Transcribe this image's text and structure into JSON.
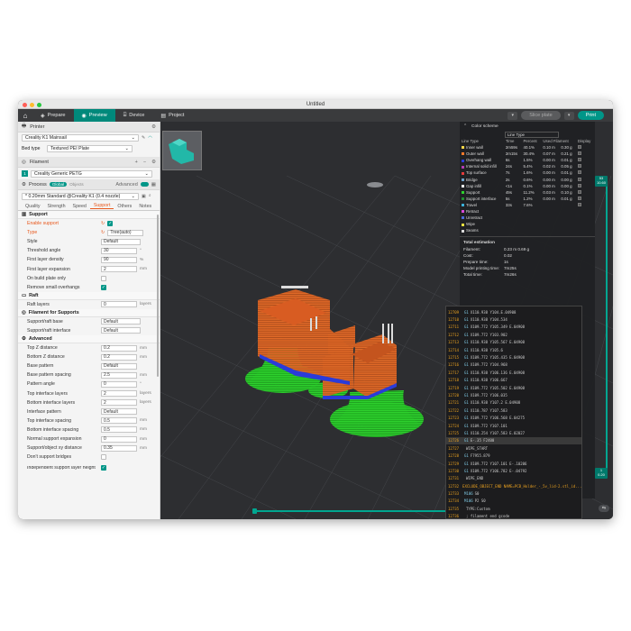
{
  "window_title": "Untitled",
  "tabs": [
    {
      "label": "Prepare",
      "icon": "cube-icon"
    },
    {
      "label": "Preview",
      "icon": "eye-icon"
    },
    {
      "label": "Device",
      "icon": "device-icon"
    },
    {
      "label": "Project",
      "icon": "project-icon"
    }
  ],
  "slice_plate_label": "Slice plate",
  "print_label": "Print",
  "printer": {
    "header": "Printer",
    "name": "Creality K1 Mainsail",
    "bed_type_label": "Bed type",
    "bed_type": "Textured PEI Plate"
  },
  "filament": {
    "header": "Filament",
    "index": "1",
    "name": "Creality Generic PETG"
  },
  "process": {
    "header": "Process",
    "global_label": "Global",
    "objects_label": "Objects",
    "advanced_label": "Advanced",
    "preset": "* 0.20mm Standard @Creality K1 (0.4 nozzle)"
  },
  "process_tabs": [
    "Quality",
    "Strength",
    "Speed",
    "Support",
    "Others",
    "Notes"
  ],
  "support_section": {
    "title": "Support",
    "enable_support": "Enable support",
    "type_label": "Type",
    "type_value": "Tree(auto)",
    "style_label": "Style",
    "style_value": "Default",
    "threshold_label": "Threshold angle",
    "threshold_value": "30",
    "threshold_unit": "°",
    "first_density_label": "First layer density",
    "first_density_value": "90",
    "first_density_unit": "%",
    "first_expansion_label": "First layer expansion",
    "first_expansion_value": "2",
    "first_expansion_unit": "mm",
    "on_build_plate_label": "On build plate only",
    "remove_small_label": "Remove small overhangs"
  },
  "raft_section": {
    "title": "Raft",
    "raft_layers_label": "Raft layers",
    "raft_layers_value": "0",
    "raft_layers_unit": "layers"
  },
  "filament_support_section": {
    "title": "Filament for Supports",
    "base_label": "Support/raft base",
    "base_value": "Default",
    "interface_label": "Support/raft interface",
    "interface_value": "Default"
  },
  "advanced_section": {
    "title": "Advanced",
    "rows": [
      {
        "label": "Top Z distance",
        "value": "0.2",
        "unit": "mm"
      },
      {
        "label": "Bottom Z distance",
        "value": "0.2",
        "unit": "mm"
      },
      {
        "label": "Base pattern",
        "value": "Default",
        "unit": ""
      },
      {
        "label": "Base pattern spacing",
        "value": "2.5",
        "unit": "mm"
      },
      {
        "label": "Pattern angle",
        "value": "0",
        "unit": "°"
      },
      {
        "label": "Top interface layers",
        "value": "2",
        "unit": "layers"
      },
      {
        "label": "Bottom interface layers",
        "value": "2",
        "unit": "layers"
      },
      {
        "label": "Interface pattern",
        "value": "Default",
        "unit": ""
      },
      {
        "label": "Top interface spacing",
        "value": "0.5",
        "unit": "mm"
      },
      {
        "label": "Bottom interface spacing",
        "value": "0.5",
        "unit": "mm"
      },
      {
        "label": "Normal support expansion",
        "value": "0",
        "unit": "mm"
      },
      {
        "label": "Support/object xy distance",
        "value": "0.35",
        "unit": "mm"
      }
    ],
    "dont_bridges_label": "Don't support bridges",
    "independent_label": "Independent support layer height"
  },
  "legend": {
    "color_scheme_label": "Color scheme",
    "scheme_value": "Line Type",
    "headers": [
      "Line Type",
      "Time",
      "Percent",
      "Used Filament",
      "Display"
    ],
    "rows": [
      {
        "name": "Inner wall",
        "color": "#f5d547",
        "time": "2m59s",
        "percent": "40.1%",
        "len": "0.10 m",
        "weight": "0.30 g"
      },
      {
        "name": "Outer wall",
        "color": "#ff7a2a",
        "time": "2m15s",
        "percent": "30.4%",
        "len": "0.07 m",
        "weight": "0.21 g"
      },
      {
        "name": "Overhang wall",
        "color": "#2a3bd9",
        "time": "6s",
        "percent": "1.5%",
        "len": "0.00 m",
        "weight": "0.01 g"
      },
      {
        "name": "Internal solid infill",
        "color": "#b23bb2",
        "time": "24s",
        "percent": "5.4%",
        "len": "0.02 m",
        "weight": "0.05 g"
      },
      {
        "name": "Top surface",
        "color": "#e23b3b",
        "time": "7s",
        "percent": "1.6%",
        "len": "0.00 m",
        "weight": "0.01 g"
      },
      {
        "name": "Bridge",
        "color": "#6fa0c8",
        "time": "2s",
        "percent": "0.6%",
        "len": "0.00 m",
        "weight": "0.00 g"
      },
      {
        "name": "Gap infill",
        "color": "#ffffff",
        "time": "<1s",
        "percent": "0.1%",
        "len": "0.00 m",
        "weight": "0.00 g"
      },
      {
        "name": "Support",
        "color": "#2ed12e",
        "time": "49s",
        "percent": "11.2%",
        "len": "0.03 m",
        "weight": "0.10 g"
      },
      {
        "name": "Support interface",
        "color": "#1e8f2e",
        "time": "5s",
        "percent": "1.2%",
        "len": "0.00 m",
        "weight": "0.01 g"
      },
      {
        "name": "Travel",
        "color": "#3ab0d8",
        "time": "33s",
        "percent": "7.6%",
        "len": "",
        "weight": ""
      },
      {
        "name": "Retract",
        "color": "#d84ad8",
        "time": "",
        "percent": "",
        "len": "",
        "weight": ""
      },
      {
        "name": "Unretract",
        "color": "#4a6ad8",
        "time": "",
        "percent": "",
        "len": "",
        "weight": ""
      },
      {
        "name": "Wipe",
        "color": "#e8e040",
        "time": "",
        "percent": "",
        "len": "",
        "weight": ""
      },
      {
        "name": "Seams",
        "color": "#d8d8d8",
        "time": "",
        "percent": "",
        "len": "",
        "weight": ""
      }
    ],
    "total_estimation_label": "Total estimation",
    "estimation": [
      {
        "k": "Filament:",
        "v": "0.23 m     0.69 g"
      },
      {
        "k": "Cost:",
        "v": "0.02"
      },
      {
        "k": "Prepare time:",
        "v": "1s"
      },
      {
        "k": "Model printing time:",
        "v": "7m25s"
      },
      {
        "k": "Total time:",
        "v": "7m26s"
      }
    ]
  },
  "gcode_lines": [
    {
      "n": "12709",
      "c": "G1",
      "t": "X110.938 Y104.E.04908"
    },
    {
      "n": "12710",
      "c": "G1",
      "t": "X110.938 Y104.534"
    },
    {
      "n": "12711",
      "c": "G1",
      "t": "X109.772 Y105.349 E.04908"
    },
    {
      "n": "12712",
      "c": "G1",
      "t": "X109.772 Y103.902"
    },
    {
      "n": "12713",
      "c": "G1",
      "t": "X110.938 Y105.567 E.04908"
    },
    {
      "n": "12714",
      "c": "G1",
      "t": "X110.938 Y105.6"
    },
    {
      "n": "12715",
      "c": "G1",
      "t": "X109.772 Y105.435 E.04908"
    },
    {
      "n": "12716",
      "c": "G1",
      "t": "X109.772 Y104.968"
    },
    {
      "n": "12717",
      "c": "G1",
      "t": "X110.938 Y106.136 E.04908"
    },
    {
      "n": "12718",
      "c": "G1",
      "t": "X110.938 Y106.667"
    },
    {
      "n": "12719",
      "c": "G1",
      "t": "X109.772 Y105.502 E.04908"
    },
    {
      "n": "12720",
      "c": "G1",
      "t": "X109.772 Y106.035"
    },
    {
      "n": "12721",
      "c": "G1",
      "t": "X110.938 Y107.2 E.04908"
    },
    {
      "n": "12722",
      "c": "G1",
      "t": "X110.787 Y107.583"
    },
    {
      "n": "12723",
      "c": "G1",
      "t": "X109.772 Y106.568 E.04275"
    },
    {
      "n": "12724",
      "c": "G1",
      "t": "X109.772 Y107.101"
    },
    {
      "n": "12725",
      "c": "G1",
      "t": "X110.254 Y107.583 E.02027"
    },
    {
      "n": "12726",
      "c": "G1",
      "t": "E-.35 F2400"
    },
    {
      "n": "12727",
      "c": "",
      "t": "WIPE_START"
    },
    {
      "n": "12728",
      "c": "G1",
      "t": "F7955.879"
    },
    {
      "n": "12729",
      "c": "G1",
      "t": "X109.772 Y107.101 E-.10206"
    },
    {
      "n": "12730",
      "c": "G1",
      "t": "X109.772 Y106.782 E-.04792"
    },
    {
      "n": "12731",
      "c": "",
      "t": "WIPE_END"
    },
    {
      "n": "12732",
      "c": "",
      "t": "EXCLUDE_OBJECT_END NAME=PCB_Holder_-_5v_lid-2.stl_id..."
    },
    {
      "n": "12733",
      "c": "M106",
      "t": "S0"
    },
    {
      "n": "12734",
      "c": "M106",
      "t": "P2 S0"
    },
    {
      "n": "12735",
      "c": "",
      "t": "TYPE:Custom"
    },
    {
      "n": "12736",
      "c": "",
      "t": "; filament end gcode"
    },
    {
      "n": "12737",
      "c": "",
      "t": "END_PRINT"
    },
    {
      "n": "12738",
      "c": "M73",
      "t": "P100 R0"
    },
    {
      "n": "12739",
      "c": "",
      "t": "; EXECUTABLE_BLOCK_END"
    },
    {
      "n": "12740",
      "c": "",
      "t": ""
    },
    {
      "n": "12741",
      "c": "",
      "t": "; filament used [mm] = 224.95"
    }
  ],
  "layer_slider": {
    "top": "53",
    "top_h": "10.60",
    "bottom": "1",
    "bottom_h": "0.20"
  },
  "horizontal_slider_label": "176"
}
